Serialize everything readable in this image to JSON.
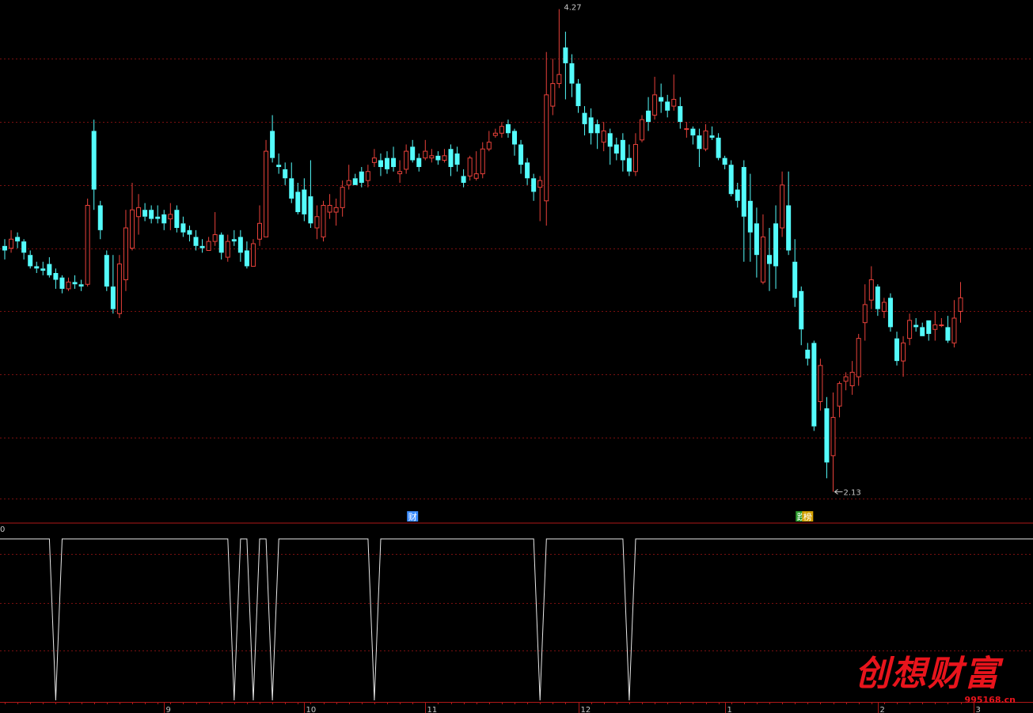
{
  "chart_data": {
    "type": "candlestick",
    "colors": {
      "up": "#e8413a",
      "down": "#54fcfc",
      "grid": "#7a1010",
      "separator": "#b01818",
      "indicator": "#e8e8e8",
      "text": "#c8c8c8"
    },
    "price_axis": {
      "ylim": [
        2.1,
        4.3
      ],
      "gridlines": [
        4.05,
        3.77,
        3.49,
        3.21,
        2.93,
        2.65,
        2.37,
        2.1
      ]
    },
    "candles": [
      [
        3.22,
        3.2,
        3.25,
        3.16
      ],
      [
        3.21,
        3.25,
        3.29,
        3.19
      ],
      [
        3.26,
        3.24,
        3.28,
        3.21
      ],
      [
        3.24,
        3.19,
        3.25,
        3.16
      ],
      [
        3.18,
        3.13,
        3.2,
        3.12
      ],
      [
        3.13,
        3.12,
        3.15,
        3.1
      ],
      [
        3.12,
        3.11,
        3.15,
        3.09
      ],
      [
        3.14,
        3.09,
        3.17,
        3.08
      ],
      [
        3.1,
        3.07,
        3.12,
        3.03
      ],
      [
        3.08,
        3.03,
        3.09,
        3.01
      ],
      [
        3.03,
        3.06,
        3.08,
        3.02
      ],
      [
        3.06,
        3.05,
        3.09,
        3.03
      ],
      [
        3.05,
        3.04,
        3.07,
        3.02
      ],
      [
        3.05,
        3.4,
        3.43,
        3.04
      ],
      [
        3.73,
        3.47,
        3.78,
        3.38
      ],
      [
        3.4,
        3.29,
        3.42,
        3.25
      ],
      [
        3.18,
        3.04,
        3.2,
        3.02
      ],
      [
        3.04,
        2.94,
        3.18,
        2.92
      ],
      [
        2.92,
        3.14,
        3.18,
        2.9
      ],
      [
        3.07,
        3.3,
        3.38,
        3.02
      ],
      [
        3.21,
        3.38,
        3.5,
        3.2
      ],
      [
        3.35,
        3.39,
        3.45,
        3.27
      ],
      [
        3.38,
        3.35,
        3.41,
        3.33
      ],
      [
        3.38,
        3.34,
        3.4,
        3.32
      ],
      [
        3.35,
        3.34,
        3.4,
        3.32
      ],
      [
        3.36,
        3.32,
        3.38,
        3.29
      ],
      [
        3.34,
        3.36,
        3.41,
        3.29
      ],
      [
        3.38,
        3.3,
        3.4,
        3.28
      ],
      [
        3.32,
        3.28,
        3.35,
        3.26
      ],
      [
        3.29,
        3.27,
        3.31,
        3.24
      ],
      [
        3.26,
        3.22,
        3.29,
        3.2
      ],
      [
        3.22,
        3.21,
        3.25,
        3.19
      ],
      [
        3.2,
        3.24,
        3.26,
        3.2
      ],
      [
        3.24,
        3.27,
        3.37,
        3.22
      ],
      [
        3.27,
        3.19,
        3.28,
        3.16
      ],
      [
        3.17,
        3.24,
        3.27,
        3.15
      ],
      [
        3.25,
        3.24,
        3.29,
        3.22
      ],
      [
        3.26,
        3.19,
        3.29,
        3.15
      ],
      [
        3.2,
        3.13,
        3.24,
        3.12
      ],
      [
        3.13,
        3.23,
        3.25,
        3.13
      ],
      [
        3.25,
        3.32,
        3.4,
        3.22
      ],
      [
        3.26,
        3.64,
        3.69,
        3.36
      ],
      [
        3.73,
        3.61,
        3.8,
        3.59
      ],
      [
        3.58,
        3.57,
        3.63,
        3.54
      ],
      [
        3.56,
        3.52,
        3.59,
        3.49
      ],
      [
        3.52,
        3.43,
        3.59,
        3.41
      ],
      [
        3.46,
        3.37,
        3.5,
        3.36
      ],
      [
        3.47,
        3.36,
        3.52,
        3.33
      ],
      [
        3.44,
        3.32,
        3.6,
        3.3
      ],
      [
        3.3,
        3.35,
        3.4,
        3.25
      ],
      [
        3.26,
        3.4,
        3.42,
        3.24
      ],
      [
        3.37,
        3.4,
        3.45,
        3.34
      ],
      [
        3.37,
        3.39,
        3.43,
        3.31
      ],
      [
        3.39,
        3.48,
        3.51,
        3.35
      ],
      [
        3.49,
        3.51,
        3.58,
        3.47
      ],
      [
        3.52,
        3.49,
        3.54,
        3.49
      ],
      [
        3.55,
        3.5,
        3.57,
        3.48
      ],
      [
        3.51,
        3.55,
        3.58,
        3.48
      ],
      [
        3.59,
        3.61,
        3.65,
        3.57
      ],
      [
        3.6,
        3.57,
        3.63,
        3.53
      ],
      [
        3.61,
        3.56,
        3.64,
        3.54
      ],
      [
        3.61,
        3.57,
        3.66,
        3.55
      ],
      [
        3.54,
        3.55,
        3.6,
        3.5
      ],
      [
        3.56,
        3.64,
        3.67,
        3.54
      ],
      [
        3.66,
        3.6,
        3.69,
        3.59
      ],
      [
        3.61,
        3.57,
        3.63,
        3.55
      ],
      [
        3.61,
        3.64,
        3.69,
        3.6
      ],
      [
        3.61,
        3.62,
        3.65,
        3.59
      ],
      [
        3.62,
        3.6,
        3.64,
        3.58
      ],
      [
        3.6,
        3.62,
        3.65,
        3.59
      ],
      [
        3.65,
        3.57,
        3.67,
        3.53
      ],
      [
        3.63,
        3.58,
        3.66,
        3.55
      ],
      [
        3.53,
        3.5,
        3.56,
        3.48
      ],
      [
        3.53,
        3.61,
        3.62,
        3.51
      ],
      [
        3.52,
        3.54,
        3.64,
        3.51
      ],
      [
        3.54,
        3.65,
        3.68,
        3.52
      ],
      [
        3.65,
        3.68,
        3.73,
        3.64
      ],
      [
        3.71,
        3.72,
        3.74,
        3.7
      ],
      [
        3.72,
        3.75,
        3.77,
        3.7
      ],
      [
        3.76,
        3.72,
        3.78,
        3.7
      ],
      [
        3.73,
        3.67,
        3.74,
        3.62
      ],
      [
        3.67,
        3.58,
        3.69,
        3.54
      ],
      [
        3.59,
        3.52,
        3.61,
        3.49
      ],
      [
        3.52,
        3.46,
        3.54,
        3.42
      ],
      [
        3.48,
        3.51,
        3.53,
        3.33
      ],
      [
        3.42,
        3.89,
        4.08,
        3.31
      ],
      [
        3.84,
        3.94,
        4.05,
        3.8
      ],
      [
        3.94,
        3.98,
        4.27,
        3.92
      ],
      [
        4.1,
        4.03,
        4.17,
        3.87
      ],
      [
        4.03,
        3.94,
        4.07,
        3.88
      ],
      [
        3.94,
        3.84,
        3.96,
        3.81
      ],
      [
        3.81,
        3.76,
        3.84,
        3.71
      ],
      [
        3.79,
        3.72,
        3.83,
        3.67
      ],
      [
        3.76,
        3.72,
        3.78,
        3.65
      ],
      [
        3.68,
        3.73,
        3.77,
        3.64
      ],
      [
        3.72,
        3.66,
        3.74,
        3.58
      ],
      [
        3.67,
        3.63,
        3.7,
        3.6
      ],
      [
        3.69,
        3.6,
        3.72,
        3.55
      ],
      [
        3.61,
        3.55,
        3.67,
        3.53
      ],
      [
        3.55,
        3.67,
        3.72,
        3.53
      ],
      [
        3.69,
        3.78,
        3.8,
        3.68
      ],
      [
        3.82,
        3.77,
        3.88,
        3.73
      ],
      [
        3.8,
        3.89,
        3.97,
        3.78
      ],
      [
        3.88,
        3.86,
        3.94,
        3.81
      ],
      [
        3.86,
        3.82,
        3.89,
        3.79
      ],
      [
        3.84,
        3.87,
        3.98,
        3.82
      ],
      [
        3.84,
        3.77,
        3.88,
        3.74
      ],
      [
        3.74,
        3.74,
        3.77,
        3.7
      ],
      [
        3.74,
        3.71,
        3.75,
        3.67
      ],
      [
        3.71,
        3.65,
        3.74,
        3.57
      ],
      [
        3.65,
        3.73,
        3.76,
        3.64
      ],
      [
        3.71,
        3.7,
        3.75,
        3.69
      ],
      [
        3.7,
        3.61,
        3.72,
        3.6
      ],
      [
        3.61,
        3.58,
        3.62,
        3.56
      ],
      [
        3.58,
        3.45,
        3.6,
        3.44
      ],
      [
        3.47,
        3.42,
        3.5,
        3.39
      ],
      [
        3.57,
        3.35,
        3.6,
        3.15
      ],
      [
        3.42,
        3.28,
        3.54,
        3.15
      ],
      [
        3.32,
        3.18,
        3.39,
        3.08
      ],
      [
        3.06,
        3.26,
        3.36,
        3.05
      ],
      [
        3.18,
        3.14,
        3.3,
        3.02
      ],
      [
        3.32,
        3.13,
        3.4,
        3.03
      ],
      [
        3.3,
        3.49,
        3.55,
        3.26
      ],
      [
        3.4,
        3.2,
        3.55,
        3.18
      ],
      [
        3.15,
        2.99,
        3.25,
        2.95
      ],
      [
        3.02,
        2.85,
        3.04,
        2.78
      ],
      [
        2.76,
        2.72,
        2.79,
        2.69
      ],
      [
        2.79,
        2.42,
        2.8,
        2.4
      ],
      [
        2.53,
        2.69,
        2.72,
        2.49
      ],
      [
        2.5,
        2.26,
        2.55,
        2.19
      ],
      [
        2.29,
        2.46,
        2.57,
        2.13
      ],
      [
        2.51,
        2.61,
        2.62,
        2.46
      ],
      [
        2.62,
        2.64,
        2.66,
        2.58
      ],
      [
        2.6,
        2.66,
        2.71,
        2.56
      ],
      [
        2.64,
        2.81,
        2.83,
        2.6
      ],
      [
        2.88,
        2.96,
        3.05,
        2.8
      ],
      [
        2.98,
        3.07,
        3.13,
        2.94
      ],
      [
        3.04,
        2.94,
        3.05,
        2.91
      ],
      [
        2.93,
        2.97,
        2.99,
        2.9
      ],
      [
        2.99,
        2.86,
        3.01,
        2.84
      ],
      [
        2.81,
        2.71,
        2.84,
        2.69
      ],
      [
        2.71,
        2.79,
        2.82,
        2.64
      ],
      [
        2.81,
        2.89,
        2.92,
        2.78
      ],
      [
        2.87,
        2.86,
        2.9,
        2.84
      ],
      [
        2.86,
        2.82,
        2.88,
        2.82
      ],
      [
        2.89,
        2.83,
        2.89,
        2.8
      ],
      [
        2.85,
        2.87,
        2.93,
        2.8
      ],
      [
        2.87,
        2.87,
        2.9,
        2.86
      ],
      [
        2.86,
        2.8,
        2.91,
        2.79
      ],
      [
        2.79,
        2.9,
        2.98,
        2.77
      ],
      [
        2.93,
        2.99,
        3.06,
        2.88
      ]
    ],
    "annotations": {
      "max_label": "4.27",
      "min_label": "2.13",
      "max_index": 87,
      "min_index": 130
    },
    "event_markers": [
      {
        "index": 64,
        "label": "财",
        "color": "#3a8cff"
      },
      {
        "index": 125,
        "label": "跌",
        "color": "#2c9c2c"
      },
      {
        "index": 126,
        "label": "榜",
        "color": "#d4a000"
      }
    ],
    "indicator": {
      "value_label": "0",
      "ylim": [
        -1,
        0
      ],
      "values": [
        0,
        0,
        0,
        0,
        0,
        0,
        0,
        0,
        -1,
        0,
        0,
        0,
        0,
        0,
        0,
        0,
        0,
        0,
        0,
        0,
        0,
        0,
        0,
        0,
        0,
        0,
        0,
        0,
        0,
        0,
        0,
        0,
        0,
        0,
        0,
        0,
        -1,
        0,
        0,
        -1,
        0,
        0,
        -1,
        0,
        0,
        0,
        0,
        0,
        0,
        0,
        0,
        0,
        0,
        0,
        0,
        0,
        0,
        0,
        -1,
        0,
        0,
        0,
        0,
        0,
        0,
        0,
        0,
        0,
        0,
        0,
        0,
        0,
        0,
        0,
        0,
        0,
        0,
        0,
        0,
        0,
        0,
        0,
        0,
        0,
        -1,
        0,
        0,
        0,
        0,
        0,
        0,
        0,
        0,
        0,
        0,
        0,
        0,
        0,
        -1,
        0,
        0,
        0,
        0,
        0,
        0,
        0,
        0,
        0,
        0,
        0,
        0,
        0,
        0,
        0,
        0,
        0,
        0,
        0,
        0,
        0,
        0,
        0,
        0,
        0,
        0,
        0,
        0,
        0,
        0,
        0,
        0,
        0,
        0,
        0,
        0,
        0,
        0,
        0,
        0,
        0,
        0,
        0,
        0,
        0,
        0,
        0,
        0,
        0,
        0,
        0,
        0,
        0,
        0,
        0,
        0
      ]
    },
    "x_axis": {
      "ticks": [
        {
          "index": 25,
          "label": "9"
        },
        {
          "index": 47,
          "label": "10"
        },
        {
          "index": 66,
          "label": "11"
        },
        {
          "index": 90,
          "label": "12"
        },
        {
          "index": 113,
          "label": "1"
        },
        {
          "index": 137,
          "label": "2"
        },
        {
          "index": 152,
          "label": "3"
        }
      ]
    }
  },
  "watermark": {
    "title": "创想财富",
    "url": "995168.cn"
  }
}
